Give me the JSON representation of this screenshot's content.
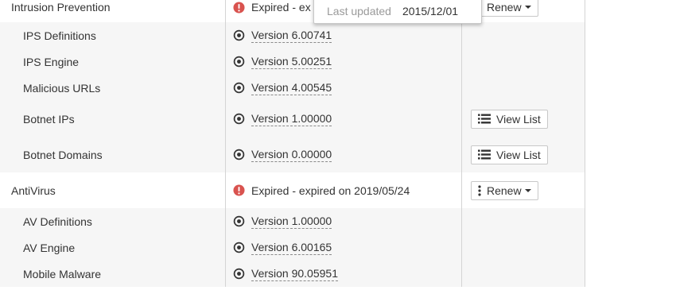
{
  "colors": {
    "error_icon": "#d9534f",
    "child_row_bg": "#f6f6f6",
    "border": "#d4d4d4"
  },
  "rows": [
    {
      "name": "Intrusion Prevention",
      "type": "parent",
      "status_icon": "exclamation-circle-icon",
      "status": "Expired - ex",
      "action": "Renew",
      "action_icon": "more-vertical-icon"
    },
    {
      "name": "IPS Definitions",
      "type": "child",
      "version": "Version 6.00741"
    },
    {
      "name": "IPS Engine",
      "type": "child",
      "version": "Version 5.00251"
    },
    {
      "name": "Malicious URLs",
      "type": "child",
      "version": "Version 4.00545"
    },
    {
      "name": "Botnet IPs",
      "type": "child",
      "version": "Version 1.00000",
      "action": "View List",
      "action_icon": "list-icon"
    },
    {
      "name": "Botnet Domains",
      "type": "child",
      "version": "Version 0.00000",
      "action": "View List",
      "action_icon": "list-icon"
    },
    {
      "name": "AntiVirus",
      "type": "parent",
      "status_icon": "exclamation-circle-icon",
      "status": "Expired - expired on 2019/05/24",
      "action": "Renew",
      "action_icon": "more-vertical-icon"
    },
    {
      "name": "AV Definitions",
      "type": "child",
      "version": "Version 1.00000"
    },
    {
      "name": "AV Engine",
      "type": "child",
      "version": "Version 6.00165"
    },
    {
      "name": "Mobile Malware",
      "type": "child",
      "version": "Version 90.05951"
    }
  ],
  "tooltip": {
    "label": "Last updated",
    "value": "2015/12/01"
  }
}
